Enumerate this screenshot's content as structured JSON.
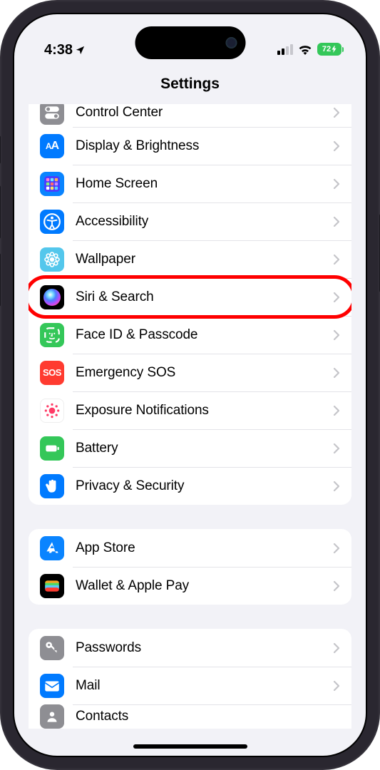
{
  "status": {
    "time": "4:38",
    "battery": "72"
  },
  "title": "Settings",
  "groups": [
    {
      "rows": [
        {
          "id": "control-center",
          "label": "Control Center",
          "icon": "switches",
          "bg": "bg-gray"
        },
        {
          "id": "display-brightness",
          "label": "Display & Brightness",
          "icon": "aa",
          "bg": "bg-blue"
        },
        {
          "id": "home-screen",
          "label": "Home Screen",
          "icon": "grid",
          "bg": "bg-blue2"
        },
        {
          "id": "accessibility",
          "label": "Accessibility",
          "icon": "accessibility",
          "bg": "bg-blue"
        },
        {
          "id": "wallpaper",
          "label": "Wallpaper",
          "icon": "flower",
          "bg": "bg-teal"
        },
        {
          "id": "siri-search",
          "label": "Siri & Search",
          "icon": "siri",
          "bg": "bg-black",
          "highlight": true
        },
        {
          "id": "face-id",
          "label": "Face ID & Passcode",
          "icon": "faceid",
          "bg": "bg-green"
        },
        {
          "id": "emergency-sos",
          "label": "Emergency SOS",
          "icon": "sos",
          "bg": "bg-red"
        },
        {
          "id": "exposure-notifications",
          "label": "Exposure Notifications",
          "icon": "exposure",
          "bg": "bg-white"
        },
        {
          "id": "battery",
          "label": "Battery",
          "icon": "battery",
          "bg": "bg-green"
        },
        {
          "id": "privacy-security",
          "label": "Privacy & Security",
          "icon": "hand",
          "bg": "bg-blue"
        }
      ]
    },
    {
      "rows": [
        {
          "id": "app-store",
          "label": "App Store",
          "icon": "appstore",
          "bg": "bg-blue2"
        },
        {
          "id": "wallet",
          "label": "Wallet & Apple Pay",
          "icon": "wallet",
          "bg": "bg-black"
        }
      ]
    },
    {
      "rows": [
        {
          "id": "passwords",
          "label": "Passwords",
          "icon": "key",
          "bg": "bg-gray"
        },
        {
          "id": "mail",
          "label": "Mail",
          "icon": "mail",
          "bg": "bg-blue"
        },
        {
          "id": "contacts",
          "label": "Contacts",
          "icon": "contacts",
          "bg": "bg-gray",
          "cutoff": true
        }
      ]
    }
  ]
}
